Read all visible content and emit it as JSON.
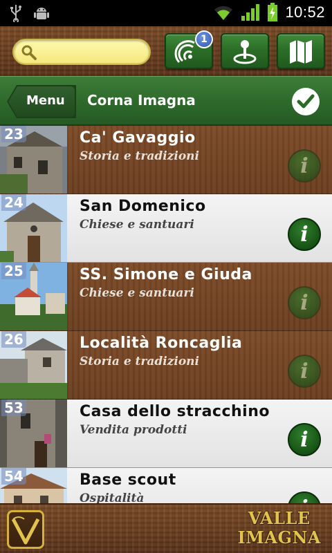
{
  "status_bar": {
    "time": "10:52",
    "icons": [
      "usb-icon",
      "android-debug-icon",
      "wifi-icon",
      "signal-icon",
      "battery-charging-icon"
    ]
  },
  "toolbar": {
    "search": {
      "value": "",
      "placeholder": ""
    },
    "buttons": [
      {
        "name": "radar-button",
        "icon": "radar-icon",
        "badge": "1"
      },
      {
        "name": "location-pin-button",
        "icon": "map-pin-icon"
      },
      {
        "name": "map-button",
        "icon": "map-icon"
      }
    ]
  },
  "header": {
    "menu_label": "Menu",
    "title": "Corna Imagna"
  },
  "list": {
    "items": [
      {
        "number": "23",
        "name": "Ca' Gavaggio",
        "category": "Storia e tradizioni",
        "style": "brown"
      },
      {
        "number": "24",
        "name": "San Domenico",
        "category": "Chiese e santuari",
        "style": "light"
      },
      {
        "number": "25",
        "name": "SS. Simone e Giuda",
        "category": "Chiese e santuari",
        "style": "brown"
      },
      {
        "number": "26",
        "name": "Località Roncaglia",
        "category": "Storia e tradizioni",
        "style": "brown"
      },
      {
        "number": "53",
        "name": "Casa dello stracchino",
        "category": "Vendita prodotti",
        "style": "light"
      },
      {
        "number": "54",
        "name": "Base scout",
        "category": "Ospitalità",
        "style": "light"
      }
    ],
    "info_label": "i"
  },
  "footer": {
    "brand_line1": "VALLE",
    "brand_line2": "IMAGNA",
    "logo_letter": "V"
  },
  "colors": {
    "wood_brown": "#6b3f1f",
    "button_green": "#2c6e28",
    "search_yellow": "#f5e87c",
    "brand_gold": "#e2c34c"
  }
}
